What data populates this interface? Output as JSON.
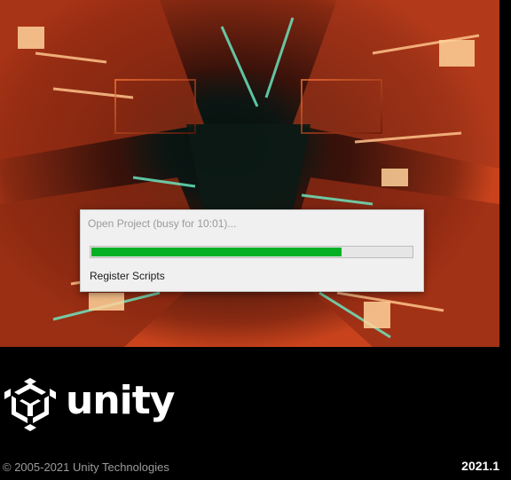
{
  "dialog": {
    "title": "Open Project (busy for 10:01)...",
    "progress_fraction": 0.78,
    "status": "Register Scripts"
  },
  "logo": {
    "icon": "unity-cube-icon",
    "text": "unity"
  },
  "footer": {
    "copyright": "© 2005-2021 Unity Technologies",
    "version": "2021.1"
  },
  "colors": {
    "background": "#000000",
    "dialog_background": "#f0f0f0",
    "progress_fill": "#06b025",
    "progress_track": "#e6e6e6"
  }
}
